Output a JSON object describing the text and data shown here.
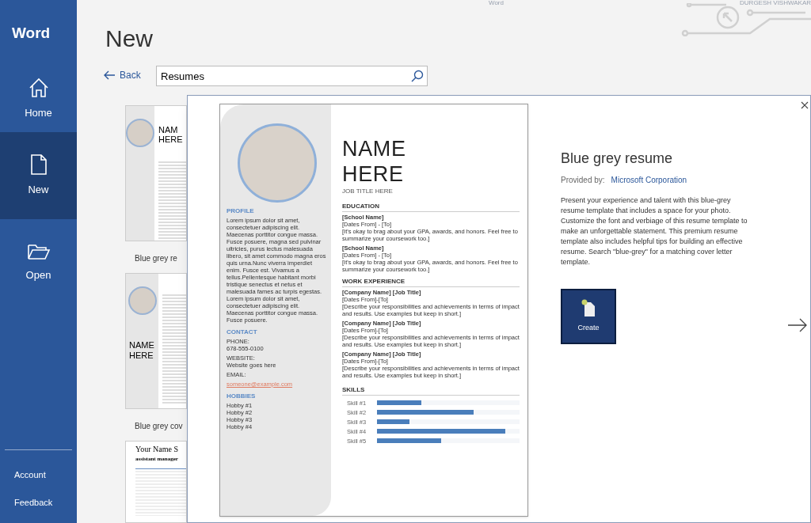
{
  "title_bar": {
    "title": "Word",
    "user": "DURGESH VISHWAKAR"
  },
  "sidebar": {
    "app": "Word",
    "items": [
      {
        "label": "Home",
        "selected": false
      },
      {
        "label": "New",
        "selected": true
      },
      {
        "label": "Open",
        "selected": false
      }
    ],
    "footer": [
      "Account",
      "Feedback"
    ]
  },
  "heading": "New",
  "back": "Back",
  "search": {
    "value": "Resumes"
  },
  "templates": [
    {
      "kind": "resume",
      "lines": [
        "NAM",
        "HERE"
      ],
      "label": "Blue grey re"
    },
    {
      "kind": "cover",
      "lines": [
        "NAME",
        "HERE"
      ],
      "label": "Blue grey cov"
    },
    {
      "kind": "classic",
      "lines": [
        "Your Name S",
        "assistant manager"
      ]
    }
  ],
  "dialog": {
    "title": "Blue grey resume",
    "provider_label": "Provided by:",
    "provider": "Microsoft Corporation",
    "description": "Present your experience and talent with this blue-grey resume template that includes a space for your photo. Customize the font and verbiage of this resume template to make an unforgettable statement. This premium resume template also includes helpful tips for building an effective resume. Search \"blue-grey\" for a matching cover letter template.",
    "create": "Create",
    "preview": {
      "name": [
        "NAME",
        "HERE"
      ],
      "job_title": "JOB TITLE HERE",
      "left": [
        {
          "heading": "PROFILE",
          "lines": [
            "Lorem ipsum dolor sit amet, consectetuer adipiscing elit. Maecenas porttitor congue massa. Fusce posuere, magna sed pulvinar ultricies, purus lectus malesuada libero, sit amet commodo magna eros quis urna.Nunc viverra imperdiet enim. Fusce est. Vivamus a tellus.Pellentesque habitant morbi tristique senectus et netus et malesuada fames ac turpis egestas. Lorem ipsum dolor sit amet, consectetuer adipiscing elit. Maecenas porttitor congue massa. Fusce posuere."
          ]
        },
        {
          "heading": "CONTACT",
          "groups": [
            [
              "PHONE:",
              "678-555-0100"
            ],
            [
              "WEBSITE:",
              "Website goes here"
            ],
            [
              "EMAIL:"
            ]
          ],
          "link": "someone@example.com"
        },
        {
          "heading": "HOBBIES",
          "lines": [
            "Hobby #1",
            "Hobby #2",
            "Hobby #3",
            "Hobby #4"
          ]
        }
      ],
      "education": {
        "heading": "EDUCATION",
        "entries": [
          {
            "title": "[School Name]",
            "dates": "[Dates From] - [To]",
            "text": "[It's okay to brag about your GPA, awards, and honors. Feel free to summarize your coursework too.]"
          },
          {
            "title": "[School Name]",
            "dates": "[Dates From] - [To]",
            "text": "[It's okay to brag about your GPA, awards, and honors. Feel free to summarize your coursework too.]"
          }
        ]
      },
      "work": {
        "heading": "WORK EXPERIENCE",
        "entries": [
          {
            "title": "[Company Name]  [Job Title]",
            "dates": "[Dates From]-[To]",
            "text": "[Describe your responsibilities and achievements in terms of impact and results. Use examples but keep in short.]"
          },
          {
            "title": "[Company Name]  [Job Title]",
            "dates": "[Dates From]-[To]",
            "text": "[Describe your responsibilities and achievements in terms of impact and results. Use examples but keep in short.]"
          },
          {
            "title": "[Company Name]  [Job Title]",
            "dates": "[Dates From]-[To]",
            "text": "[Describe your responsibilities and achievements in terms of impact and results. Use examples but keep in short.]"
          }
        ]
      },
      "skills": {
        "heading": "SKILLS",
        "items": [
          {
            "label": "Skill #1",
            "level": 0.31
          },
          {
            "label": "Skill #2",
            "level": 0.68
          },
          {
            "label": "Skill #3",
            "level": 0.23
          },
          {
            "label": "Skill #4",
            "level": 0.9
          },
          {
            "label": "Skill #5",
            "level": 0.45
          }
        ]
      }
    }
  }
}
